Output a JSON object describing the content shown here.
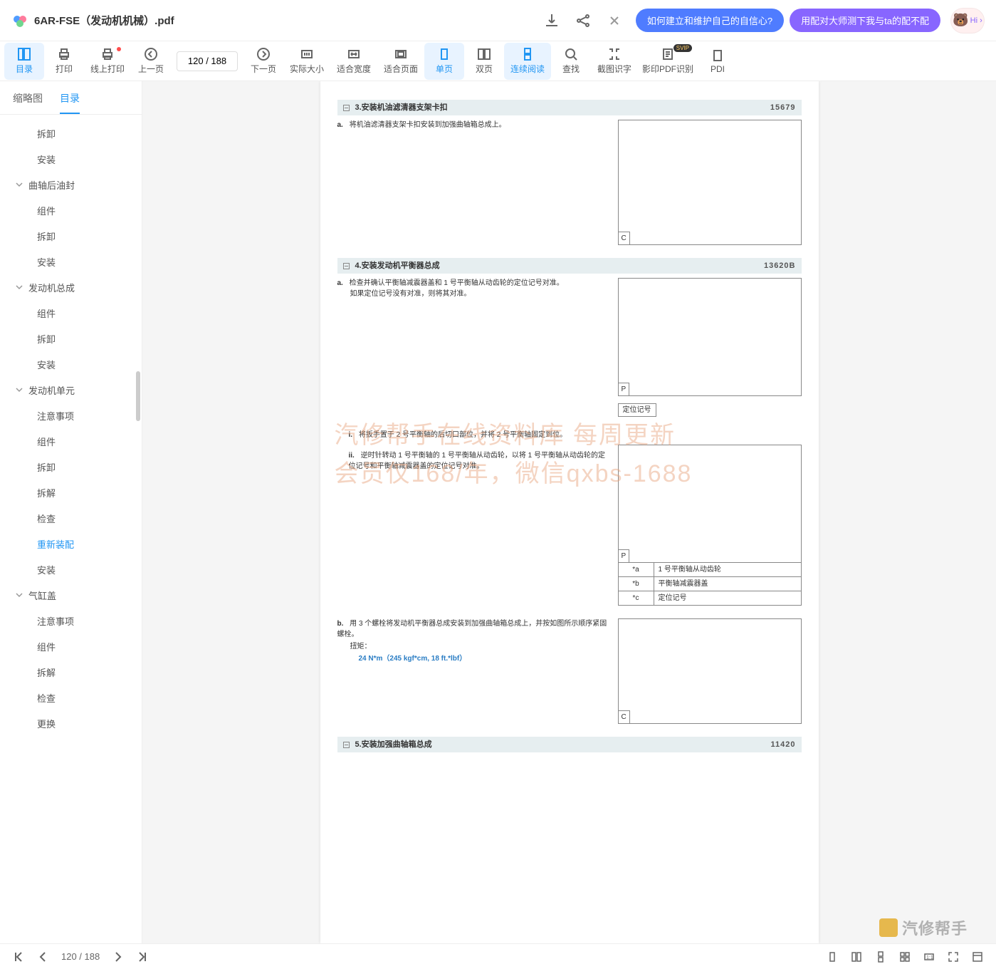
{
  "titlebar": {
    "filename": "6AR-FSE（发动机机械）.pdf",
    "pill1": "如何建立和维护自己的自信心?",
    "pill2": "用配对大师测下我与ta的配不配",
    "avatar_text": "Hi ›"
  },
  "toolbar": {
    "toc": "目录",
    "print": "打印",
    "online_print": "线上打印",
    "prev": "上一页",
    "page_value": "120 / 188",
    "next": "下一页",
    "actual_size": "实际大小",
    "fit_width": "适合宽度",
    "fit_page": "适合页面",
    "single_page": "单页",
    "double_page": "双页",
    "continuous": "连续阅读",
    "find": "查找",
    "screenshot_ocr": "截图识字",
    "shadow_pdf": "影印PDF识别",
    "svip": "SVIP",
    "pdf_tail": "PDI"
  },
  "side_tabs": {
    "thumb": "缩略图",
    "toc": "目录"
  },
  "tree": [
    {
      "label": "拆卸",
      "level": 1
    },
    {
      "label": "安装",
      "level": 1
    },
    {
      "label": "曲轴后油封",
      "level": 0,
      "expanded": true
    },
    {
      "label": "组件",
      "level": 1
    },
    {
      "label": "拆卸",
      "level": 1
    },
    {
      "label": "安装",
      "level": 1
    },
    {
      "label": "发动机总成",
      "level": 0,
      "expanded": true
    },
    {
      "label": "组件",
      "level": 1
    },
    {
      "label": "拆卸",
      "level": 1
    },
    {
      "label": "安装",
      "level": 1
    },
    {
      "label": "发动机单元",
      "level": 0,
      "expanded": true
    },
    {
      "label": "注意事项",
      "level": 1
    },
    {
      "label": "组件",
      "level": 1
    },
    {
      "label": "拆卸",
      "level": 1
    },
    {
      "label": "拆解",
      "level": 1
    },
    {
      "label": "检查",
      "level": 1
    },
    {
      "label": "重新装配",
      "level": 1,
      "selected": true
    },
    {
      "label": "安装",
      "level": 1
    },
    {
      "label": "气缸盖",
      "level": 0,
      "expanded": true
    },
    {
      "label": "注意事项",
      "level": 1
    },
    {
      "label": "组件",
      "level": 1
    },
    {
      "label": "拆解",
      "level": 1
    },
    {
      "label": "检查",
      "level": 1
    },
    {
      "label": "更换",
      "level": 1
    }
  ],
  "doc": {
    "sec3": {
      "title": "3.安装机油滤清器支架卡扣",
      "code": "15679"
    },
    "sec3_a": "将机油滤清器支架卡扣安装到加强曲轴箱总成上。",
    "sec4": {
      "title": "4.安装发动机平衡器总成",
      "code": "13620B"
    },
    "sec4_a_l1": "检查并确认平衡轴减震器盖和 1 号平衡轴从动齿轮的定位记号对准。",
    "sec4_a_l2": "如果定位记号没有对准，则将其对准。",
    "sec4_caption1": "定位记号",
    "sec4_i": "将扳手置于 2 号平衡轴的后切口部位，并将 2 号平衡轴固定到位。",
    "sec4_ii": "逆时针转动 1 号平衡轴的 1 号平衡轴从动齿轮，以将 1 号平衡轴从动齿轮的定位记号和平衡轴减震器盖的定位记号对准。",
    "callout": [
      {
        "k": "*a",
        "v": "1 号平衡轴从动齿轮"
      },
      {
        "k": "*b",
        "v": "平衡轴减震器盖"
      },
      {
        "k": "*c",
        "v": "定位记号"
      }
    ],
    "sec4_b": "用 3 个螺栓将发动机平衡器总成安装到加强曲轴箱总成上，并按如图所示顺序紧固螺栓。",
    "torque_label": "扭矩：",
    "torque_value": "24 N*m（245 kgf*cm, 18 ft.*lbf）",
    "sec5": {
      "title": "5.安装加强曲轴箱总成",
      "code": "11420"
    },
    "corner_c": "C",
    "corner_p": "P",
    "watermark_l1": "汽修帮手在线资料库  每周更新",
    "watermark_l2": "会员仅168/年，微信qxbs-1688",
    "bottom_wm": "汽修帮手"
  },
  "bottombar": {
    "page": "120 / 188"
  },
  "labels": {
    "a": "a.",
    "b": "b.",
    "i": "i.",
    "ii": "ii."
  }
}
